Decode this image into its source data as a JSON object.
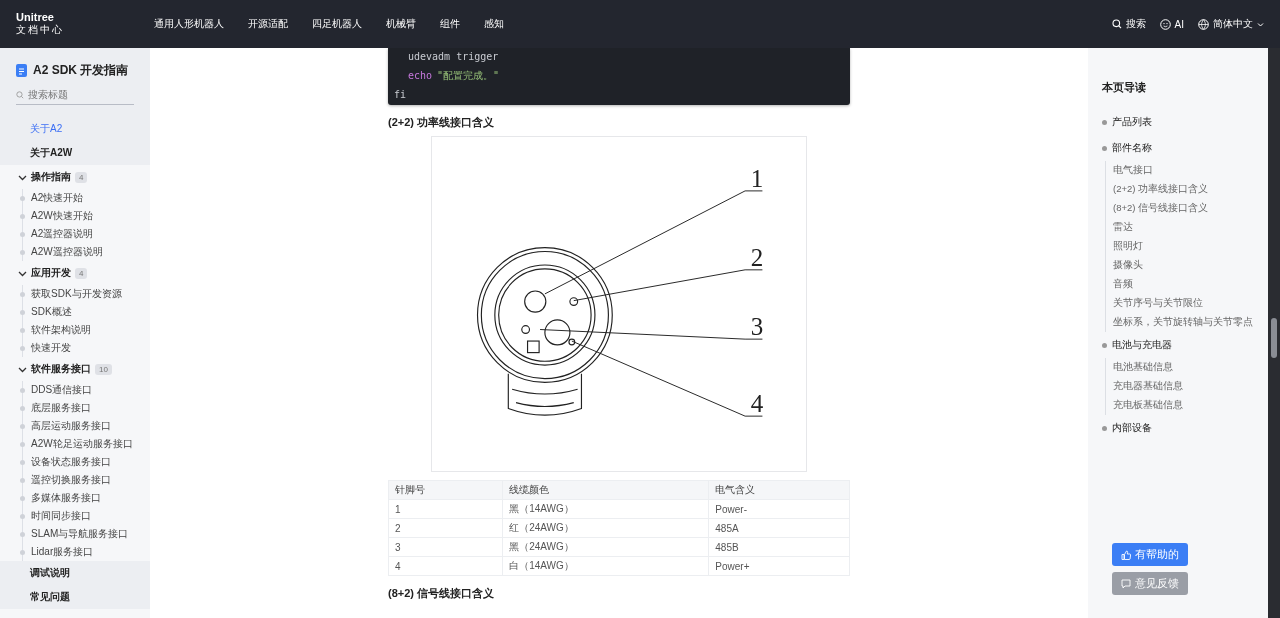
{
  "header": {
    "logo": {
      "name": "Unitree",
      "subtitle": "文档中心"
    },
    "nav": [
      "通用人形机器人",
      "开源适配",
      "四足机器人",
      "机械臂",
      "组件",
      "感知"
    ],
    "actions": {
      "search": "搜索",
      "ai": "AI",
      "language": "简体中文"
    }
  },
  "sidebar": {
    "title": "A2 SDK 开发指南",
    "search": {
      "placeholder": "搜索标题"
    },
    "items": [
      {
        "label": "关于A2",
        "selected": true
      },
      {
        "label": "关于A2W",
        "selected": false
      },
      {
        "label": "操作指南",
        "count": "4",
        "expanded": true,
        "selected": false,
        "children": [
          {
            "label": "A2快速开始",
            "selected": false
          },
          {
            "label": "A2W快速开始",
            "selected": false
          },
          {
            "label": "A2遥控器说明",
            "selected": false
          },
          {
            "label": "A2W遥控器说明",
            "selected": false
          }
        ]
      },
      {
        "label": "应用开发",
        "count": "4",
        "expanded": true,
        "selected": false,
        "children": [
          {
            "label": "获取SDK与开发资源",
            "selected": false
          },
          {
            "label": "SDK概述",
            "selected": false
          },
          {
            "label": "软件架构说明",
            "selected": false
          },
          {
            "label": "快速开发",
            "selected": false
          }
        ]
      },
      {
        "label": "软件服务接口",
        "count": "10",
        "expanded": true,
        "selected": false,
        "children": [
          {
            "label": "DDS通信接口",
            "selected": false
          },
          {
            "label": "底层服务接口",
            "selected": false
          },
          {
            "label": "高层运动服务接口",
            "selected": false
          },
          {
            "label": "A2W轮足运动服务接口",
            "selected": false
          },
          {
            "label": "设备状态服务接口",
            "selected": false
          },
          {
            "label": "遥控切换服务接口",
            "selected": false
          },
          {
            "label": "多媒体服务接口",
            "selected": false
          },
          {
            "label": "时间同步接口",
            "selected": false
          },
          {
            "label": "SLAM与导航服务接口",
            "selected": false
          },
          {
            "label": "Lidar服务接口",
            "selected": false
          }
        ]
      },
      {
        "label": "调试说明",
        "selected": false
      },
      {
        "label": "常见问题",
        "selected": false
      }
    ]
  },
  "content": {
    "code_lines": [
      {
        "indent": true,
        "tokens": [
          {
            "kind": "plain",
            "text": "udevadm trigger"
          }
        ]
      },
      {
        "indent": true,
        "tokens": [
          {
            "kind": "keyword",
            "text": "echo"
          },
          {
            "kind": "string",
            "text": "\"配置完成。\""
          }
        ]
      },
      {
        "indent": false,
        "tokens": [
          {
            "kind": "plain",
            "text": "fi"
          }
        ]
      }
    ],
    "heading": "(2+2) 功率线接口含义",
    "figure": {
      "callouts": [
        "1",
        "2",
        "3",
        "4"
      ]
    },
    "table": {
      "columns": [
        "针脚号",
        "线缆颜色",
        "电气含义"
      ],
      "rows": [
        [
          "1",
          "黑（14AWG）",
          "Power-"
        ],
        [
          "2",
          "红（24AWG）",
          "485A"
        ],
        [
          "3",
          "黑（24AWG）",
          "485B"
        ],
        [
          "4",
          "白（14AWG）",
          "Power+"
        ]
      ]
    },
    "next_heading": "(8+2) 信号线接口含义"
  },
  "toc": {
    "title": "本页导读",
    "items": [
      {
        "label": "产品列表"
      },
      {
        "label": "部件名称",
        "children": [
          "电气接口",
          "(2+2) 功率线接口含义",
          "(8+2) 信号线接口含义",
          "雷达",
          "照明灯",
          "摄像头",
          "音频",
          "关节序号与关节限位",
          "坐标系，关节旋转轴与关节零点"
        ]
      },
      {
        "label": "电池与充电器",
        "children": [
          "电池基础信息",
          "充电器基础信息",
          "充电板基础信息"
        ]
      },
      {
        "label": "内部设备"
      }
    ]
  },
  "feedback": [
    {
      "label": "有帮助的",
      "kind": "primary"
    },
    {
      "label": "意见反馈",
      "kind": "secondary"
    }
  ]
}
